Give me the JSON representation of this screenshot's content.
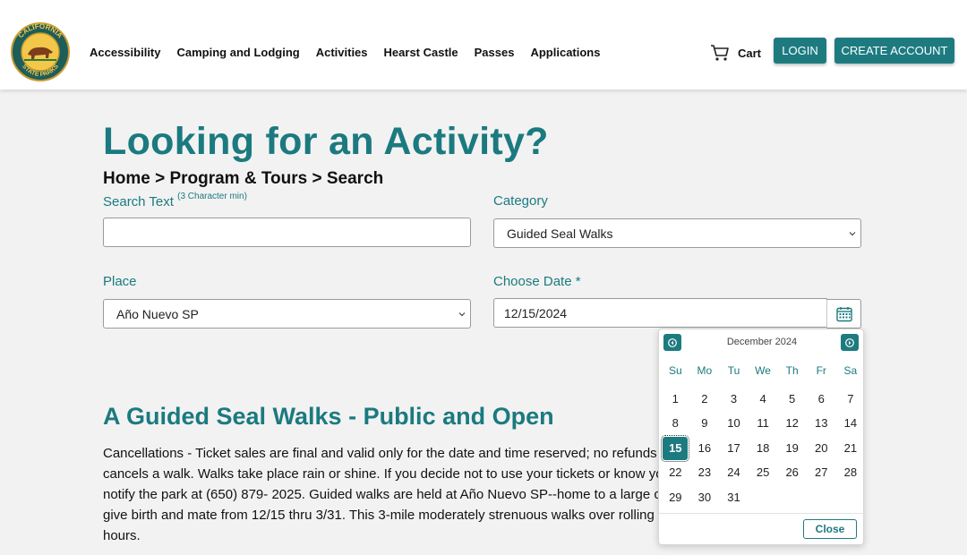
{
  "header": {
    "logo_text": "CALIFORNIA STATE PARKS",
    "nav": [
      "Accessibility",
      "Camping and Lodging",
      "Activities",
      "Hearst Castle",
      "Passes",
      "Applications"
    ],
    "cart_label": "Cart",
    "login_label": "LOGIN",
    "create_account_label": "CREATE ACCOUNT"
  },
  "main": {
    "title": "Looking for an Activity?",
    "breadcrumb": "Home >  Program & Tours > Search",
    "search": {
      "label": "Search Text",
      "hint": "(3 Character min)",
      "value": ""
    },
    "category": {
      "label": "Category",
      "value": "Guided Seal Walks"
    },
    "place": {
      "label": "Place",
      "value": "Año Nuevo SP"
    },
    "date": {
      "label": "Choose Date *",
      "value": "12/15/2024"
    },
    "section_title": "A Guided Seal Walks - Public and Open",
    "description_lines": [
      "Cancellations - Ticket sales are final and valid only for the date and time reserved; no refunds unless the park",
      "cancels a walk. Walks take place rain or shine. If you decide not to use your tickets or know you will be late,",
      "notify the park at (650) 879- 2025. Guided walks are held at Año Nuevo SP--home to a large colony of seals that",
      "give birth and mate from 12/15 thru 3/31. This 3-mile moderately strenuous walks over rolling dunes lasts 2.5",
      "hours."
    ]
  },
  "datepicker": {
    "month_title": "December 2024",
    "weekdays": [
      "Su",
      "Mo",
      "Tu",
      "We",
      "Th",
      "Fr",
      "Sa"
    ],
    "weeks": [
      [
        "1",
        "2",
        "3",
        "4",
        "5",
        "6",
        "7"
      ],
      [
        "8",
        "9",
        "10",
        "11",
        "12",
        "13",
        "14"
      ],
      [
        "15",
        "16",
        "17",
        "18",
        "19",
        "20",
        "21"
      ],
      [
        "22",
        "23",
        "24",
        "25",
        "26",
        "27",
        "28"
      ],
      [
        "29",
        "30",
        "31",
        "",
        "",
        "",
        ""
      ]
    ],
    "selected_day": "15",
    "close_label": "Close"
  },
  "colors": {
    "accent": "#1d7b80",
    "heading": "#1b7a7f",
    "background": "#f2f2f2"
  },
  "icons": [
    "cart-icon",
    "chevron-down-icon",
    "calendar-icon",
    "chevron-left-icon",
    "chevron-right-icon"
  ]
}
